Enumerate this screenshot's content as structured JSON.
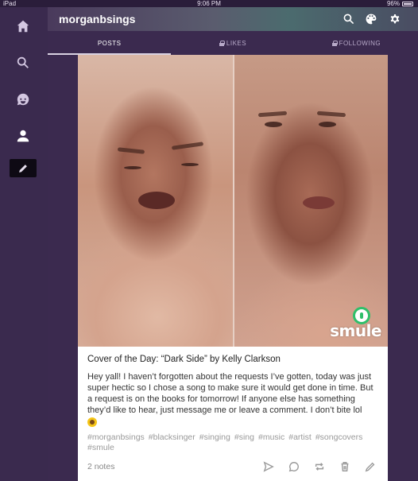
{
  "status_bar": {
    "device": "iPad",
    "time": "9:06 PM",
    "battery": "96%"
  },
  "header": {
    "blog_name": "morganbsings"
  },
  "header_icons": [
    "search-icon",
    "palette-icon",
    "gear-icon"
  ],
  "nav_icons": [
    "home-icon",
    "search-icon",
    "chat-icon",
    "account-icon",
    "compose-icon"
  ],
  "tabs": [
    {
      "label": "POSTS",
      "locked": false,
      "active": true
    },
    {
      "label": "LIKES",
      "locked": true,
      "active": false
    },
    {
      "label": "FOLLOWING",
      "locked": true,
      "active": false
    }
  ],
  "post": {
    "media_watermark": "smule",
    "title": "Cover of the Day: “Dark Side” by Kelly Clarkson",
    "body": "Hey yall! I haven’t forgotten about the requests I’ve gotten, today was just super hectic so I chose a song to make sure it would get done in time. But a request is on the books for tomorrow! If anyone else has something they’d like to hear, just message me or leave a comment. I don’t bite lol",
    "tags": [
      "#morganbsings",
      "#blacksinger",
      "#singing",
      "#sing",
      "#music",
      "#artist",
      "#songcovers",
      "#smule"
    ],
    "notes": "2 notes",
    "actions": [
      "share-icon",
      "reply-icon",
      "reblog-icon",
      "delete-icon",
      "edit-icon"
    ]
  },
  "colors": {
    "background": "#3b2a4f",
    "card": "#ffffff",
    "smule_green": "#2fbf6a"
  }
}
